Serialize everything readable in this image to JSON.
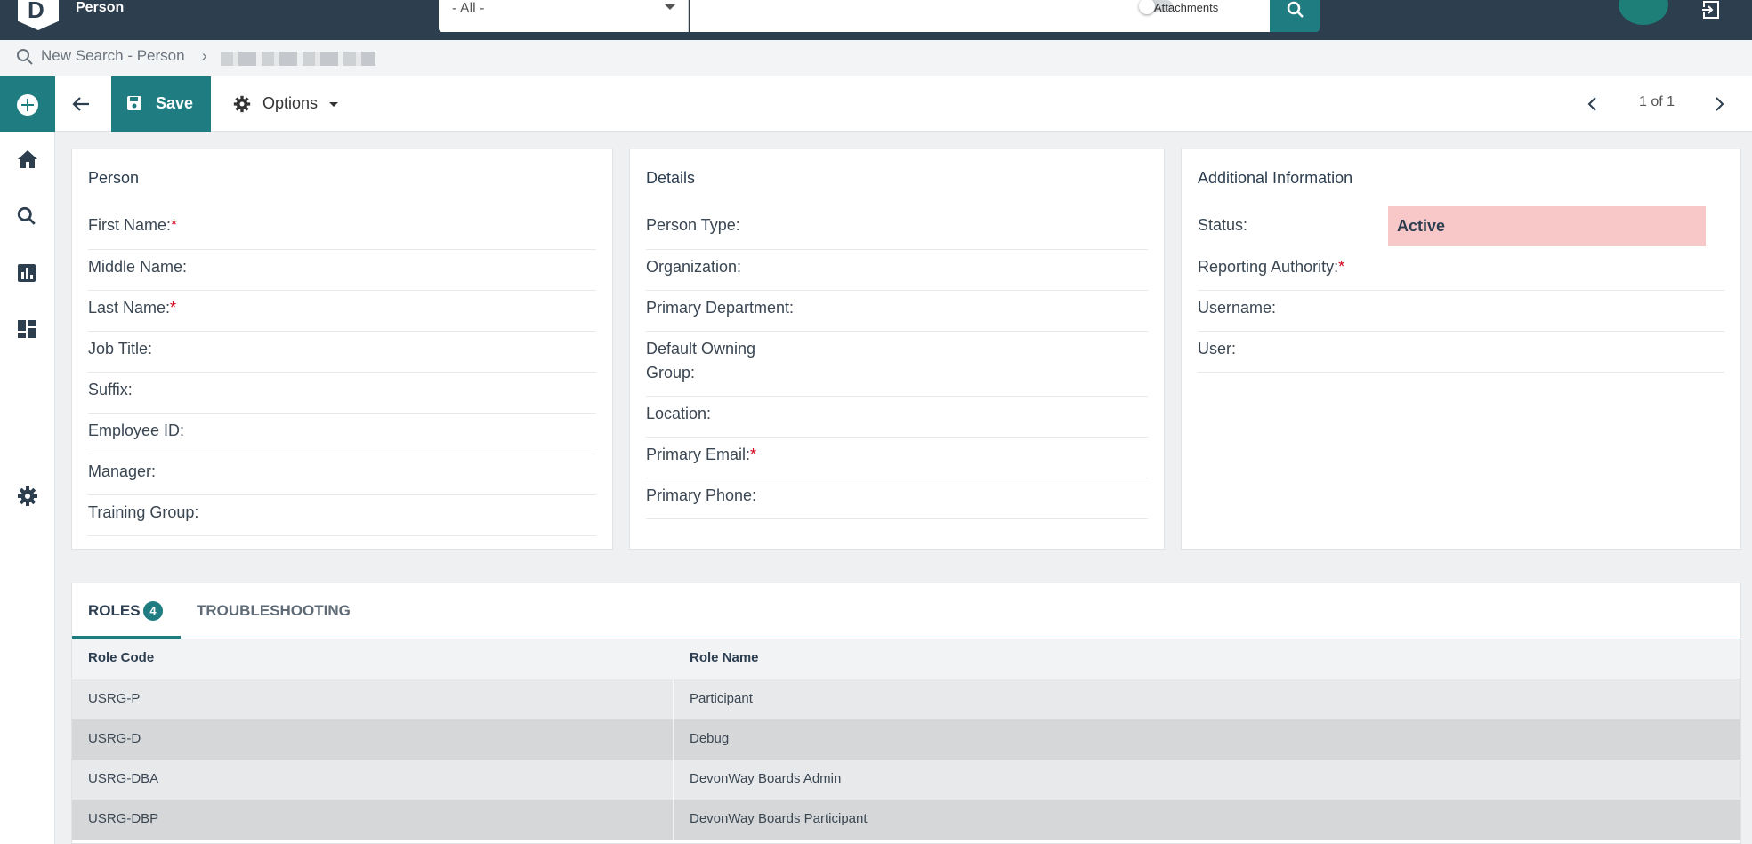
{
  "app": {
    "title": "Person"
  },
  "search": {
    "scope": "- All -",
    "attachments_label": "Attachments"
  },
  "breadcrumb": {
    "link": "New Search - Person",
    "separator": "›"
  },
  "toolbar": {
    "save_label": "Save",
    "options_label": "Options",
    "pager": "1 of 1"
  },
  "panels": {
    "person": {
      "title": "Person",
      "fields": [
        "First Name:",
        "Middle Name:",
        "Last Name:",
        "Job Title:",
        "Suffix:",
        "Employee ID:",
        "Manager:",
        "Training Group:"
      ]
    },
    "details": {
      "title": "Details",
      "fields": [
        "Person Type:",
        "Organization:",
        "Primary Department:",
        "Default Owning",
        "Group:",
        "Location:",
        "Primary Email:",
        "Primary Phone:"
      ]
    },
    "additional": {
      "title": "Additional Information",
      "fields": [
        "Status:",
        "Reporting Authority:",
        "Username:",
        "User:"
      ],
      "status_value": "Active",
      "status_color": "#f8c8c9"
    }
  },
  "required_mark": "*",
  "tabs": [
    {
      "label": "ROLES",
      "badge": "4"
    },
    {
      "label": "TROUBLESHOOTING"
    }
  ],
  "roles_table": {
    "headers": [
      "Role Code",
      "Role Name"
    ],
    "rows": [
      [
        "USRG-P",
        "Participant"
      ],
      [
        "USRG-D",
        "Debug"
      ],
      [
        "USRG-DBA",
        "DevonWay Boards Admin"
      ],
      [
        "USRG-DBP",
        "DevonWay Boards Participant"
      ]
    ]
  },
  "colors": {
    "accent": "#1f7d82",
    "topbar": "#2d3e4e"
  },
  "icons": [
    "search-icon",
    "plus-icon",
    "home-icon",
    "bar-chart-icon",
    "dashboard-icon",
    "gear-icon",
    "arrow-left-icon",
    "save-icon",
    "chevron-left-icon",
    "chevron-right-icon",
    "logout-icon"
  ]
}
